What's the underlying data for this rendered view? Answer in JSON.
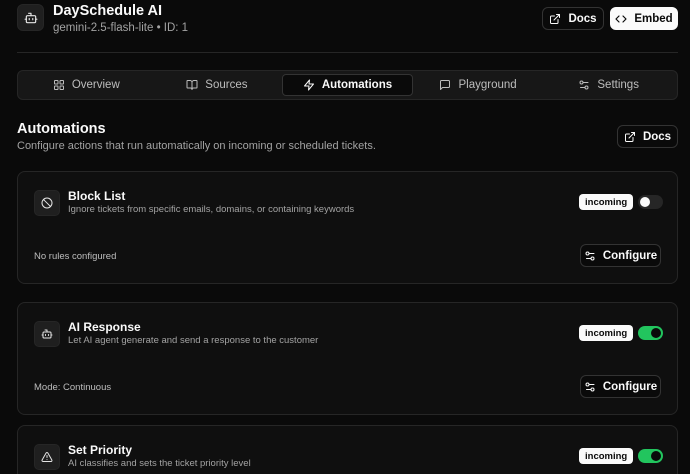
{
  "app": {
    "title": "DaySchedule AI",
    "model": "gemini-2.5-flash-lite",
    "separator": "•",
    "id_label": "ID: 1"
  },
  "header": {
    "docs_label": "Docs",
    "embed_label": "Embed"
  },
  "tabs": [
    {
      "label": "Overview",
      "icon": "grid-icon",
      "active": false
    },
    {
      "label": "Sources",
      "icon": "book-icon",
      "active": false
    },
    {
      "label": "Automations",
      "icon": "zap-icon",
      "active": true
    },
    {
      "label": "Playground",
      "icon": "chat-icon",
      "active": false
    },
    {
      "label": "Settings",
      "icon": "sliders-icon",
      "active": false
    }
  ],
  "section": {
    "title": "Automations",
    "subtitle": "Configure actions that run automatically on incoming or scheduled tickets.",
    "docs_label": "Docs"
  },
  "automations": [
    {
      "title": "Block List",
      "description": "Ignore tickets from specific emails, domains, or containing keywords",
      "icon": "ban-icon",
      "badge": "incoming",
      "enabled": false,
      "footer": "No rules configured",
      "configure_label": "Configure"
    },
    {
      "title": "AI Response",
      "description": "Let AI agent generate and send a response to the customer",
      "icon": "bot-icon",
      "badge": "incoming",
      "enabled": true,
      "footer": "Mode: Continuous",
      "configure_label": "Configure"
    },
    {
      "title": "Set Priority",
      "description": "AI classifies and sets the ticket priority level",
      "icon": "alert-triangle-icon",
      "badge": "incoming",
      "enabled": true
    }
  ],
  "colors": {
    "background": "#0a0a0a",
    "card": "#0f0f0f",
    "border": "#262626",
    "toggle_on": "#22c55e",
    "text": "#fafafa",
    "muted": "#a3a3a3"
  }
}
